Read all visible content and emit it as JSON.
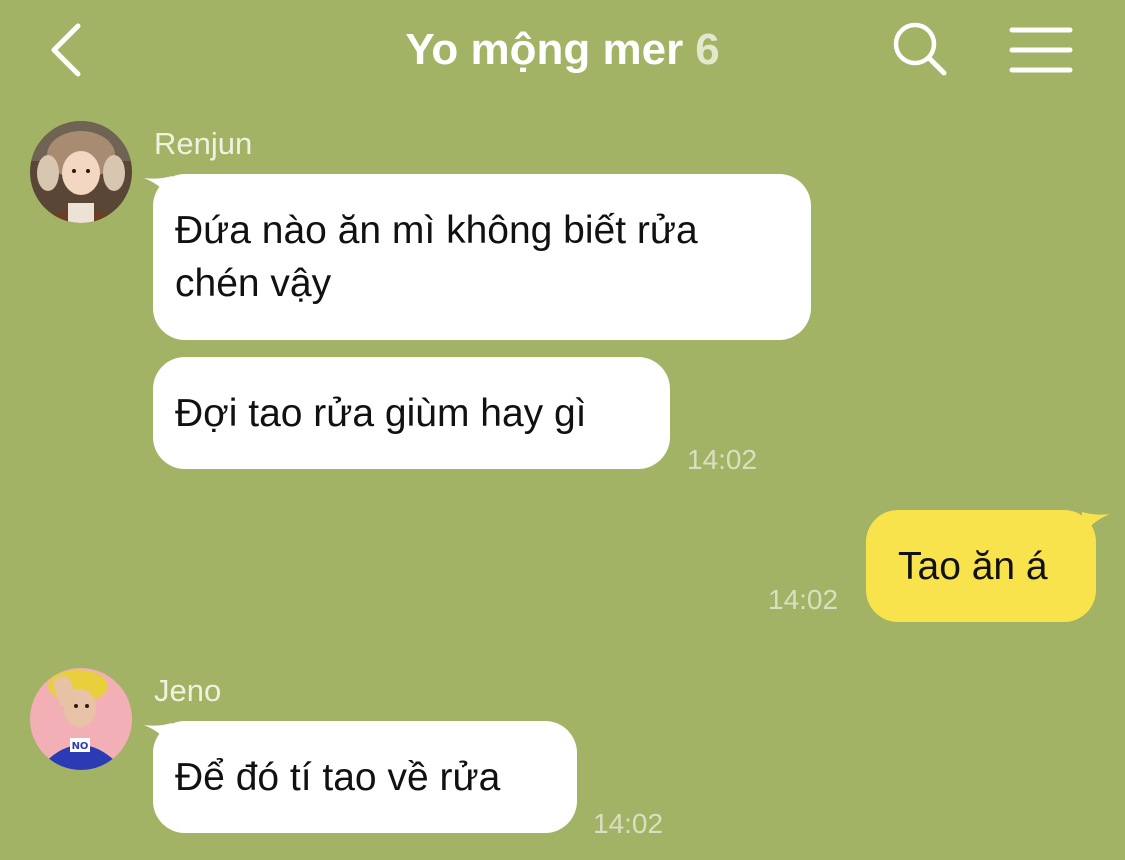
{
  "header": {
    "title": "Yo mộng mer",
    "member_count": "6"
  },
  "messages": [
    {
      "sender": "Renjun",
      "text": "Đứa nào ăn mì không biết rửa\nchén vậy"
    },
    {
      "sender": "Renjun",
      "text": "Đợi tao rửa giùm hay gì",
      "time": "14:02"
    },
    {
      "sender": "me",
      "text": "Tao ăn á",
      "time": "14:02"
    },
    {
      "sender": "Jeno",
      "text": "Để đó tí tao về rửa",
      "time": "14:02"
    }
  ],
  "colors": {
    "background": "#a2b365",
    "incoming_bubble": "#ffffff",
    "outgoing_bubble": "#f8e34d"
  },
  "icons": {
    "back": "chevron-left-icon",
    "search": "search-icon",
    "menu": "hamburger-menu-icon"
  }
}
